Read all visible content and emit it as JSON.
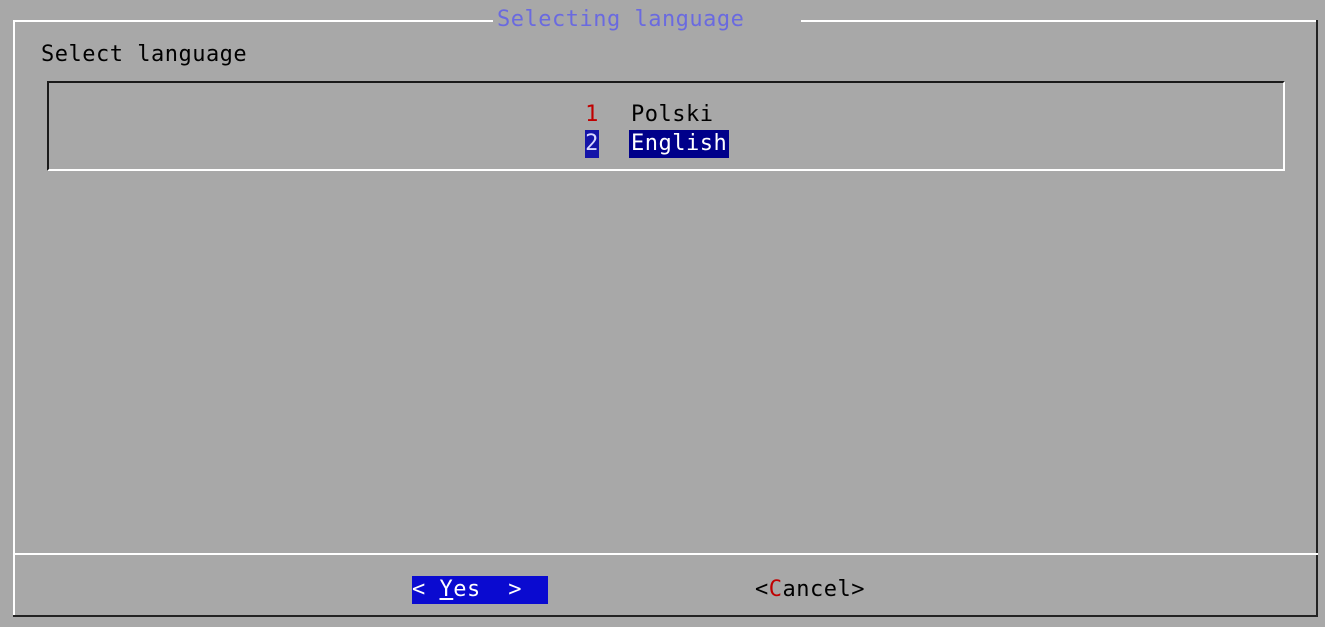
{
  "dialog": {
    "title": "Selecting language",
    "prompt": "Select language"
  },
  "list": {
    "items": [
      {
        "tag": "1",
        "label": "Polski",
        "selected": false
      },
      {
        "tag": "2",
        "label": "English",
        "selected": true
      }
    ]
  },
  "buttons": {
    "yes": {
      "left_bracket": "< ",
      "hotkey": "Y",
      "rest": "es",
      "right_bracket": "  >"
    },
    "cancel": {
      "left_bracket": "<",
      "hotkey": "C",
      "rest": "ancel",
      "right_bracket": ">"
    }
  },
  "colors": {
    "background": "#a8a8a8",
    "title": "#6a6ae0",
    "selection": "#00008a",
    "button_active": "#0a0ad0",
    "hotkey": "#c00000"
  }
}
